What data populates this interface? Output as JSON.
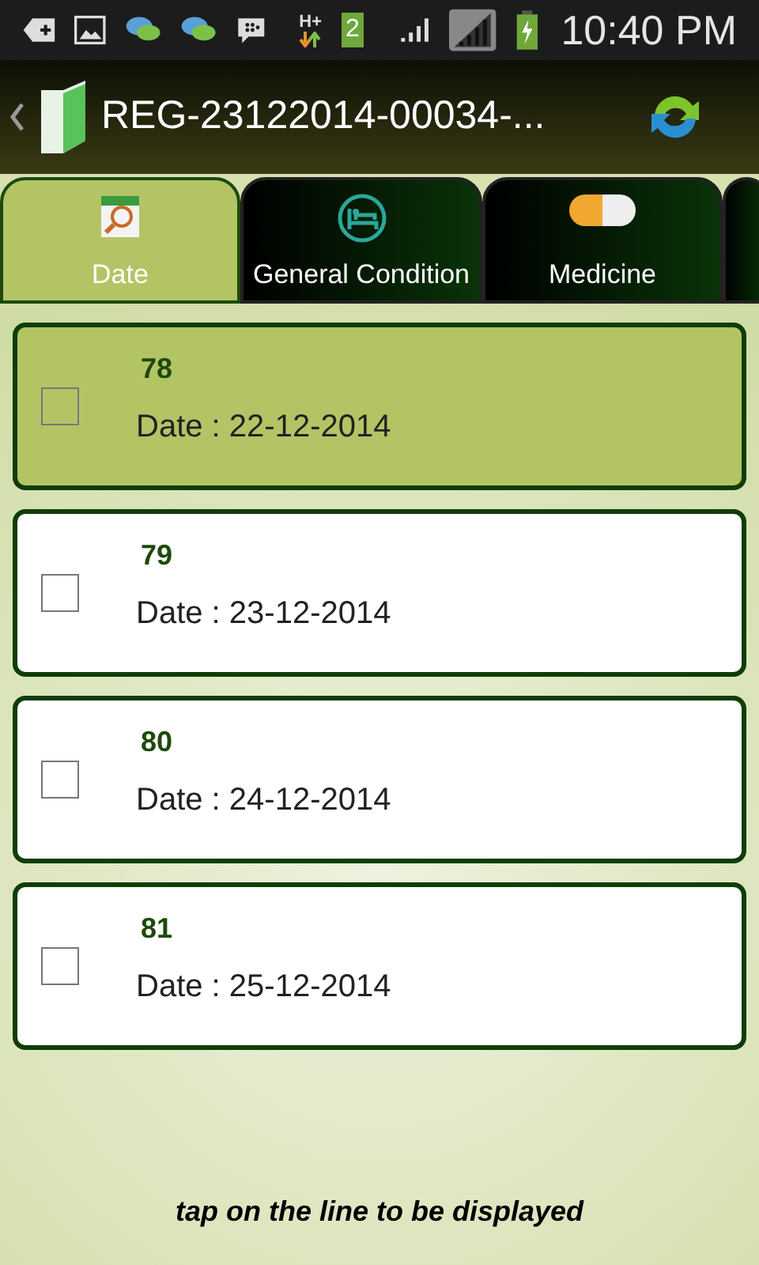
{
  "status_bar": {
    "network": "H+",
    "sim_badge": "2",
    "time": "10:40 PM"
  },
  "action_bar": {
    "title": "REG-23122014-00034-..."
  },
  "tabs": [
    {
      "label": "Date",
      "kind": "calendar",
      "selected": true
    },
    {
      "label": "General Condition",
      "kind": "bed",
      "selected": false
    },
    {
      "label": "Medicine",
      "kind": "pill",
      "selected": false
    },
    {
      "kind": "cut",
      "selected": false
    }
  ],
  "records": [
    {
      "number": "78",
      "date": "Date : 22-12-2014",
      "selected": true,
      "checked": false
    },
    {
      "number": "79",
      "date": "Date : 23-12-2014",
      "selected": false,
      "checked": false
    },
    {
      "number": "80",
      "date": "Date : 24-12-2014",
      "selected": false,
      "checked": false
    },
    {
      "number": "81",
      "date": "Date : 25-12-2014",
      "selected": false,
      "checked": false
    }
  ],
  "hint": "tap on the line to be displayed"
}
